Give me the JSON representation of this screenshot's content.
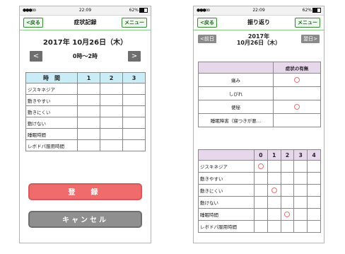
{
  "status": {
    "signal": "●●●oo",
    "time": "22:09",
    "battery": "62%"
  },
  "left": {
    "back_label": "<戻る",
    "title": "症状記録",
    "menu_label": "メニュー",
    "date": "2017年 10月26日（木）",
    "time_slot": "0時〜2時",
    "prev_arrow": "<",
    "next_arrow": ">",
    "columns": [
      "時　間",
      "1",
      "2",
      "3"
    ],
    "rows": [
      "ジスキネジア",
      "動きやすい",
      "動きにくい",
      "動けない",
      "睡眠時間",
      "レボドパ服用時間"
    ],
    "register_label": "登　録",
    "cancel_label": "キャンセル"
  },
  "right": {
    "back_label": "<戻る",
    "title": "振り返り",
    "menu_label": "メニュー",
    "prev_day": "<前日",
    "next_day": "翌日>",
    "date_line1": "2017年",
    "date_line2": "10月26日（木）",
    "symptom_header": "症状の有無",
    "symptoms": [
      {
        "label": "痛み",
        "present": true
      },
      {
        "label": "しびれ",
        "present": false
      },
      {
        "label": "便秘",
        "present": true
      },
      {
        "label": "睡眠障害（寝つきが悪…",
        "present": false
      }
    ],
    "hour_columns": [
      "",
      "0",
      "1",
      "2",
      "3",
      "4"
    ],
    "hour_rows": [
      {
        "label": "ジスキネジア",
        "marked_hour": "0"
      },
      {
        "label": "動きやすい",
        "marked_hour": ""
      },
      {
        "label": "動きにくい",
        "marked_hour": "1"
      },
      {
        "label": "動けない",
        "marked_hour": ""
      },
      {
        "label": "睡眠時間",
        "marked_hour": "2"
      },
      {
        "label": "レボドパ服用時間",
        "marked_hour": ""
      }
    ]
  },
  "colors": {
    "accent_green": "#3a8a3a",
    "header_blue": "#c9ecf6",
    "header_purple": "#e6d8ea",
    "register_red": "#f06b6b",
    "cancel_gray": "#8f8f8f",
    "mark_red": "#e57373"
  }
}
